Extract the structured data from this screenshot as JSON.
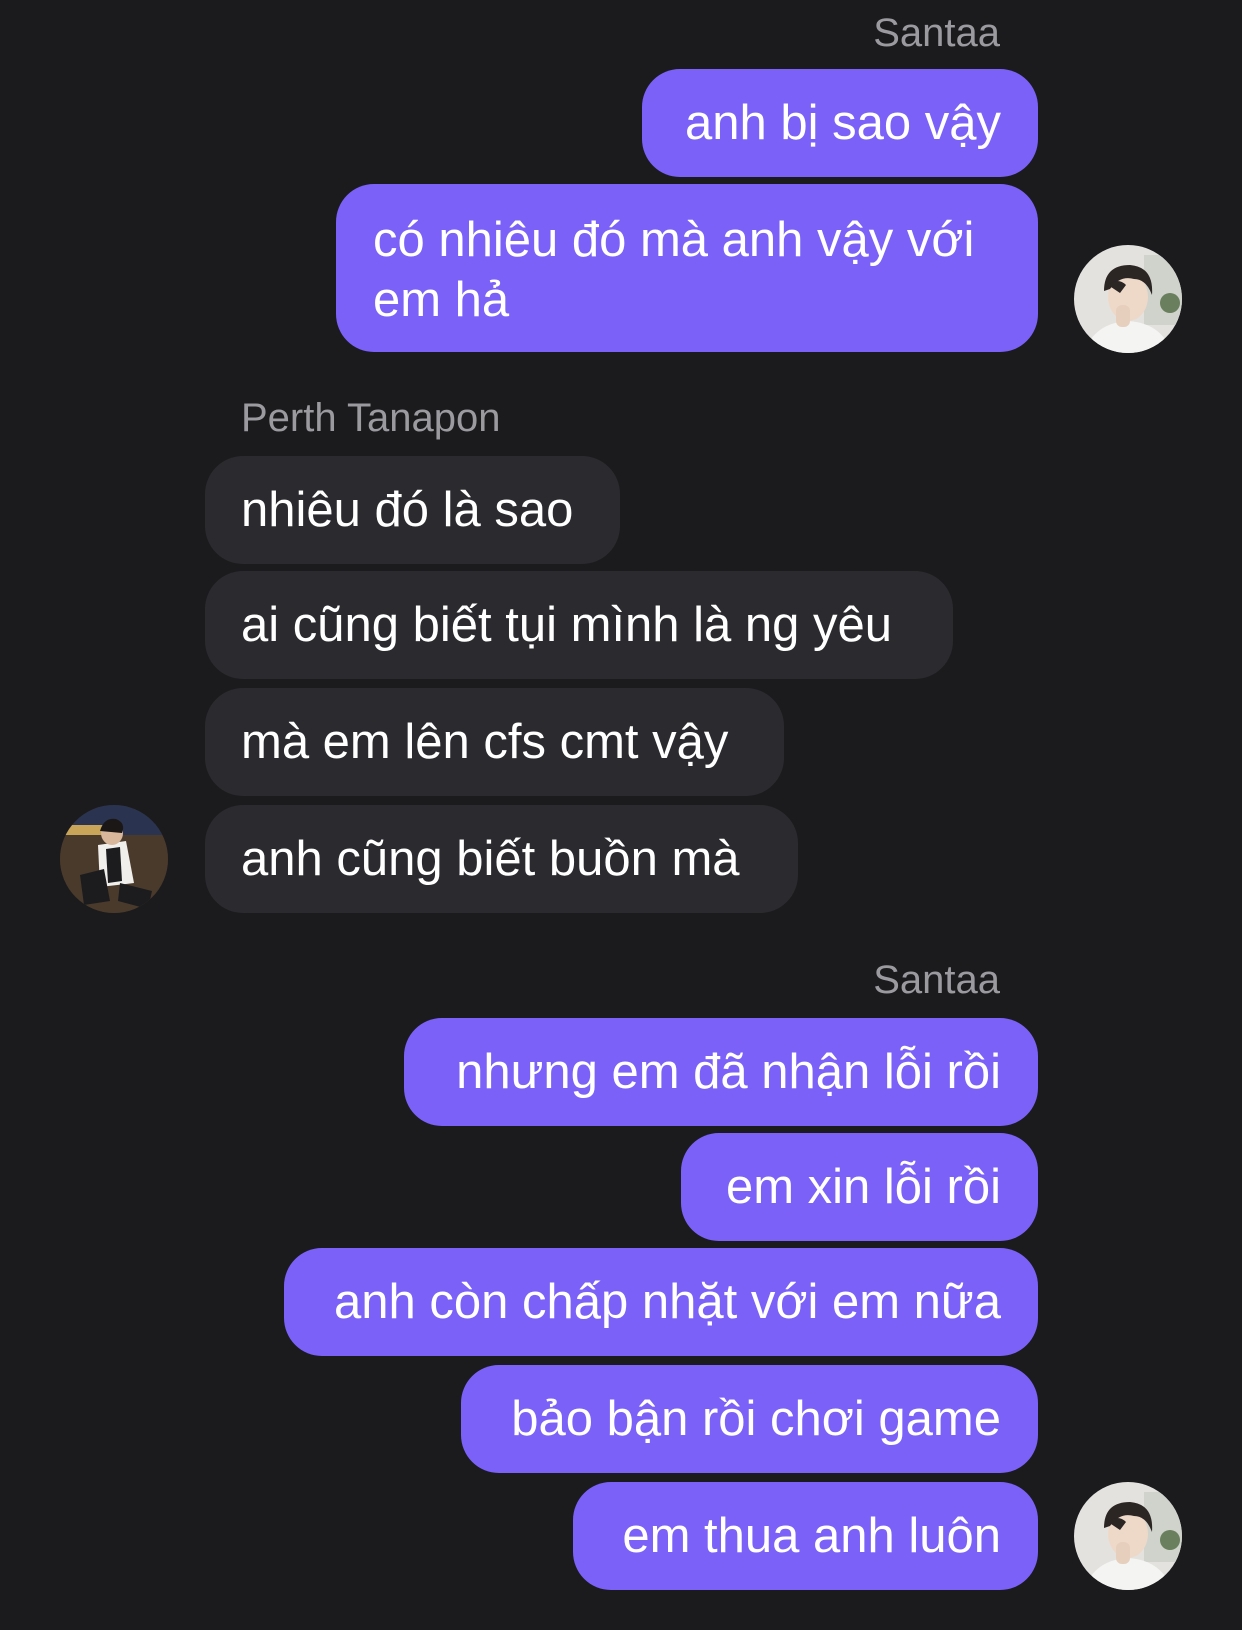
{
  "conversation": {
    "groups": [
      {
        "sender": "Santaa",
        "messages": [
          "anh bị sao vậy",
          "có nhiêu đó mà anh vậy với em hả"
        ]
      },
      {
        "sender": "Perth Tanapon",
        "messages": [
          "nhiêu đó là sao",
          "ai cũng biết tụi mình là ng yêu",
          "mà em lên cfs cmt vậy",
          "anh cũng biết buồn mà"
        ]
      },
      {
        "sender": "Santaa",
        "messages": [
          "nhưng em đã nhận lỗi rồi",
          "em xin lỗi rồi",
          "anh còn chấp nhặt với em nữa",
          "bảo bận rồi chơi game",
          "em thua anh luôn"
        ]
      }
    ]
  },
  "colors": {
    "background": "#1b1b1e",
    "outgoing_bubble": "#7b61f8",
    "incoming_bubble": "#2b2b2f",
    "sender_name": "#9a9a9f"
  }
}
